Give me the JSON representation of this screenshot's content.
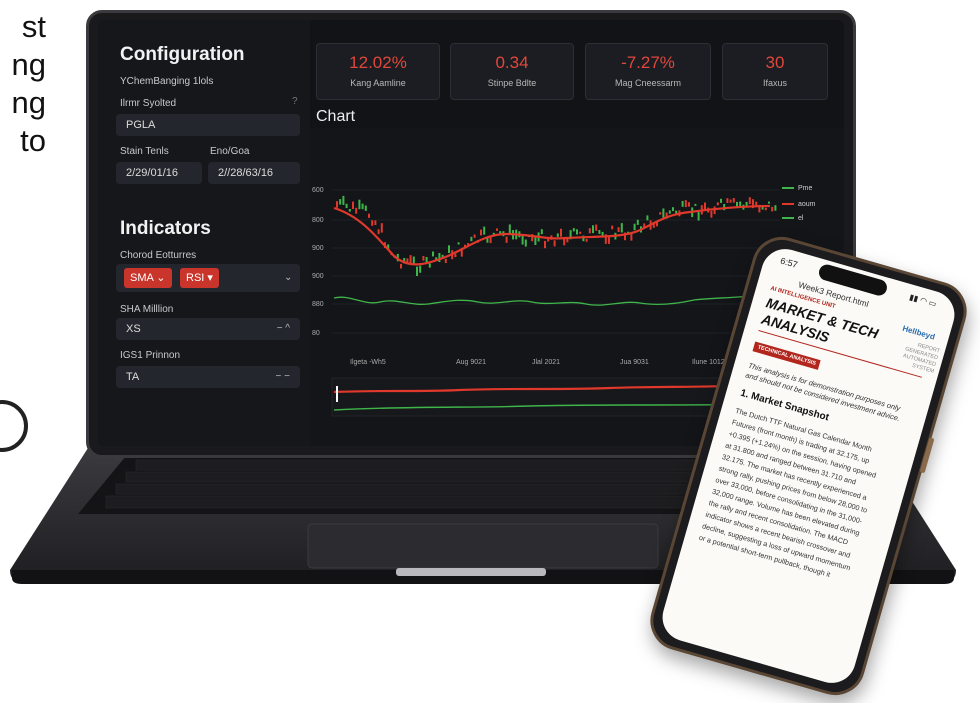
{
  "left_text": {
    "lines": [
      "st",
      "ng",
      "ng",
      "to"
    ]
  },
  "sidebar": {
    "title": "Configuration",
    "subtitle": "YChemBanging 1lols",
    "field1_label": "Ilrmr Syolted",
    "field1_value": "PGLA",
    "start_label": "Stain Tenls",
    "end_label": "Eno/Goa",
    "start_value": "2/29/01/16",
    "end_value": "2//28/63/16",
    "indicators_title": "Indicators",
    "indicators_label": "Chorod Eotturres",
    "chips": [
      "SMA",
      "RSI"
    ],
    "sma_label": "SHA Milllion",
    "sma_value": "XS",
    "rsi_label": "IGS1 Prinnon",
    "rsi_value": "TA"
  },
  "metrics": [
    {
      "value": "12.02%",
      "label": "Kang Aamline"
    },
    {
      "value": "0.34",
      "label": "Stinpe Bdlte"
    },
    {
      "value": "-7.27%",
      "label": "Mag Cneessarm"
    },
    {
      "value": "30",
      "label": "Ifaxus"
    }
  ],
  "chart": {
    "title": "Chart",
    "y_ticks": [
      "600",
      "800",
      "900",
      "900",
      "880",
      "80"
    ],
    "x_ticks": [
      "Ilgeta -Wh5",
      "Aug 9021",
      "Jlal 2021",
      "Jua 9031",
      "Ilune 1012"
    ],
    "legend": [
      "Pme",
      "aoum",
      "el"
    ]
  },
  "phone": {
    "time": "6:57",
    "file": "Week3 Report.html",
    "unit": "AI INTELLIGENCE UNIT",
    "title_l1": "MARKET & TECH",
    "title_l2": "ANALYSIS",
    "logo": "Hellbeyd",
    "side_l1": "REPORT",
    "side_l2": "GENERATED",
    "side_l3": "AUTOMATED",
    "side_l4": "SYSTEM",
    "tag": "TECHNICAL ANALYSIS",
    "disclaimer_l1": "This analysis is for demonstration purposes only",
    "disclaimer_l2": "and should not be considered investment advice.",
    "section": "1. Market Snapshot",
    "body": [
      "The Dutch TTF Natural Gas Calendar Month",
      "Futures (front month) is trading at 32.175, up",
      "+0.395 (+1.24%) on the session, having opened",
      "at 31.800 and ranged between 31.710 and",
      "32.175. The market has recently experienced a",
      "strong rally, pushing prices from below 28,000 to",
      "over 33,000, before consolidating in the 31,000-",
      "32,000 range. Volume has been elevated during",
      "the rally and recent consolidation. The MACD",
      "indicator shows a recent bearish crossover and",
      "decline, suggesting a loss of upward momentum",
      "or a potential short-term pullback, though it"
    ]
  }
}
